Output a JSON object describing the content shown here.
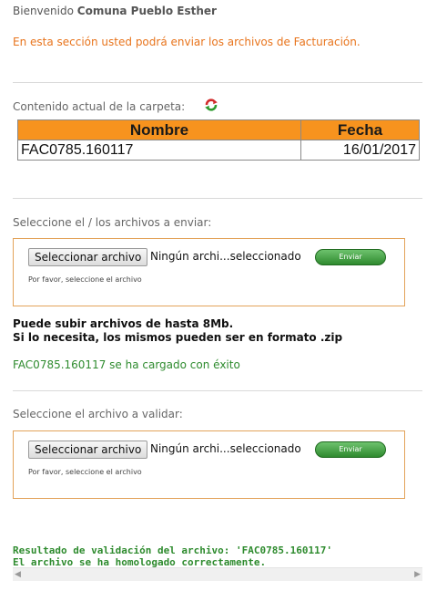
{
  "header": {
    "welcome_prefix": "Bienvenido",
    "welcome_name": "Comuna Pueblo Esther",
    "intro": "En esta sección usted podrá enviar los archivos de Facturación."
  },
  "folder": {
    "label": "Contenido actual de la carpeta:",
    "refresh_icon": "refresh-icon",
    "columns": {
      "name": "Nombre",
      "date": "Fecha"
    },
    "rows": [
      {
        "name": "FAC0785.160117",
        "date": "16/01/2017"
      }
    ]
  },
  "upload": {
    "label": "Seleccione el / los archivos a enviar:",
    "select_button": "Seleccionar archivo",
    "no_file": "Ningún archi...seleccionado",
    "send_button": "Enviar",
    "hint": "Por favor, seleccione el archivo",
    "limit_line1": "Puede subir archivos de hasta 8Mb.",
    "limit_line2": "Si lo necesita, los mismos pueden ser en formato .zip",
    "success": "FAC0785.160117 se ha cargado con éxito"
  },
  "validate": {
    "label": "Seleccione el archivo a validar:",
    "select_button": "Seleccionar archivo",
    "no_file": "Ningún archi...seleccionado",
    "send_button": "Enviar",
    "hint": "Por favor, seleccione el archivo",
    "result_line1": "Resultado de validación del archivo: 'FAC0785.160117'",
    "result_line2": "El archivo se ha homologado correctamente."
  },
  "colors": {
    "accent_orange": "#f7931e",
    "intro_orange": "#e8741c",
    "success_green": "#2e8b2e"
  }
}
